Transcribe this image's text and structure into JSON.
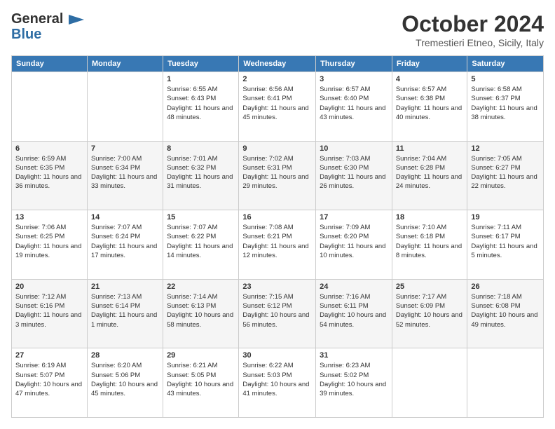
{
  "header": {
    "logo_line1": "General",
    "logo_line2": "Blue",
    "month_title": "October 2024",
    "location": "Tremestieri Etneo, Sicily, Italy"
  },
  "weekdays": [
    "Sunday",
    "Monday",
    "Tuesday",
    "Wednesday",
    "Thursday",
    "Friday",
    "Saturday"
  ],
  "weeks": [
    [
      {
        "day": "",
        "info": ""
      },
      {
        "day": "",
        "info": ""
      },
      {
        "day": "1",
        "info": "Sunrise: 6:55 AM\nSunset: 6:43 PM\nDaylight: 11 hours and 48 minutes."
      },
      {
        "day": "2",
        "info": "Sunrise: 6:56 AM\nSunset: 6:41 PM\nDaylight: 11 hours and 45 minutes."
      },
      {
        "day": "3",
        "info": "Sunrise: 6:57 AM\nSunset: 6:40 PM\nDaylight: 11 hours and 43 minutes."
      },
      {
        "day": "4",
        "info": "Sunrise: 6:57 AM\nSunset: 6:38 PM\nDaylight: 11 hours and 40 minutes."
      },
      {
        "day": "5",
        "info": "Sunrise: 6:58 AM\nSunset: 6:37 PM\nDaylight: 11 hours and 38 minutes."
      }
    ],
    [
      {
        "day": "6",
        "info": "Sunrise: 6:59 AM\nSunset: 6:35 PM\nDaylight: 11 hours and 36 minutes."
      },
      {
        "day": "7",
        "info": "Sunrise: 7:00 AM\nSunset: 6:34 PM\nDaylight: 11 hours and 33 minutes."
      },
      {
        "day": "8",
        "info": "Sunrise: 7:01 AM\nSunset: 6:32 PM\nDaylight: 11 hours and 31 minutes."
      },
      {
        "day": "9",
        "info": "Sunrise: 7:02 AM\nSunset: 6:31 PM\nDaylight: 11 hours and 29 minutes."
      },
      {
        "day": "10",
        "info": "Sunrise: 7:03 AM\nSunset: 6:30 PM\nDaylight: 11 hours and 26 minutes."
      },
      {
        "day": "11",
        "info": "Sunrise: 7:04 AM\nSunset: 6:28 PM\nDaylight: 11 hours and 24 minutes."
      },
      {
        "day": "12",
        "info": "Sunrise: 7:05 AM\nSunset: 6:27 PM\nDaylight: 11 hours and 22 minutes."
      }
    ],
    [
      {
        "day": "13",
        "info": "Sunrise: 7:06 AM\nSunset: 6:25 PM\nDaylight: 11 hours and 19 minutes."
      },
      {
        "day": "14",
        "info": "Sunrise: 7:07 AM\nSunset: 6:24 PM\nDaylight: 11 hours and 17 minutes."
      },
      {
        "day": "15",
        "info": "Sunrise: 7:07 AM\nSunset: 6:22 PM\nDaylight: 11 hours and 14 minutes."
      },
      {
        "day": "16",
        "info": "Sunrise: 7:08 AM\nSunset: 6:21 PM\nDaylight: 11 hours and 12 minutes."
      },
      {
        "day": "17",
        "info": "Sunrise: 7:09 AM\nSunset: 6:20 PM\nDaylight: 11 hours and 10 minutes."
      },
      {
        "day": "18",
        "info": "Sunrise: 7:10 AM\nSunset: 6:18 PM\nDaylight: 11 hours and 8 minutes."
      },
      {
        "day": "19",
        "info": "Sunrise: 7:11 AM\nSunset: 6:17 PM\nDaylight: 11 hours and 5 minutes."
      }
    ],
    [
      {
        "day": "20",
        "info": "Sunrise: 7:12 AM\nSunset: 6:16 PM\nDaylight: 11 hours and 3 minutes."
      },
      {
        "day": "21",
        "info": "Sunrise: 7:13 AM\nSunset: 6:14 PM\nDaylight: 11 hours and 1 minute."
      },
      {
        "day": "22",
        "info": "Sunrise: 7:14 AM\nSunset: 6:13 PM\nDaylight: 10 hours and 58 minutes."
      },
      {
        "day": "23",
        "info": "Sunrise: 7:15 AM\nSunset: 6:12 PM\nDaylight: 10 hours and 56 minutes."
      },
      {
        "day": "24",
        "info": "Sunrise: 7:16 AM\nSunset: 6:11 PM\nDaylight: 10 hours and 54 minutes."
      },
      {
        "day": "25",
        "info": "Sunrise: 7:17 AM\nSunset: 6:09 PM\nDaylight: 10 hours and 52 minutes."
      },
      {
        "day": "26",
        "info": "Sunrise: 7:18 AM\nSunset: 6:08 PM\nDaylight: 10 hours and 49 minutes."
      }
    ],
    [
      {
        "day": "27",
        "info": "Sunrise: 6:19 AM\nSunset: 5:07 PM\nDaylight: 10 hours and 47 minutes."
      },
      {
        "day": "28",
        "info": "Sunrise: 6:20 AM\nSunset: 5:06 PM\nDaylight: 10 hours and 45 minutes."
      },
      {
        "day": "29",
        "info": "Sunrise: 6:21 AM\nSunset: 5:05 PM\nDaylight: 10 hours and 43 minutes."
      },
      {
        "day": "30",
        "info": "Sunrise: 6:22 AM\nSunset: 5:03 PM\nDaylight: 10 hours and 41 minutes."
      },
      {
        "day": "31",
        "info": "Sunrise: 6:23 AM\nSunset: 5:02 PM\nDaylight: 10 hours and 39 minutes."
      },
      {
        "day": "",
        "info": ""
      },
      {
        "day": "",
        "info": ""
      }
    ]
  ]
}
